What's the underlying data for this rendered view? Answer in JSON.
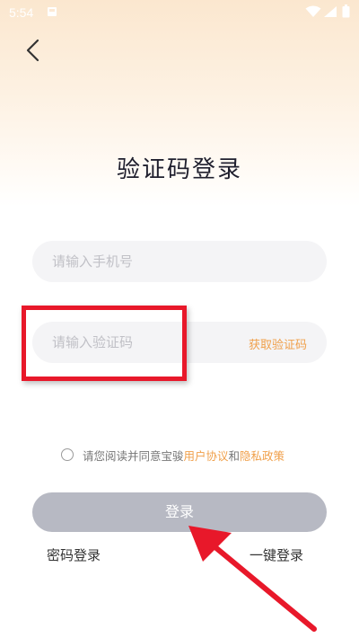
{
  "status_bar": {
    "time": "5:54"
  },
  "page": {
    "title": "验证码登录"
  },
  "form": {
    "phone_placeholder": "请输入手机号",
    "code_placeholder": "请输入验证码",
    "get_code_label": "获取验证码"
  },
  "agreement": {
    "prefix": "请您阅读并同意宝骏",
    "user_agreement": "用户协议",
    "and": "和",
    "privacy_policy": "隐私政策"
  },
  "actions": {
    "login_label": "登录",
    "password_login": "密码登录",
    "one_key_login": "一键登录"
  },
  "colors": {
    "accent": "#f0a04b",
    "button_disabled": "#b7b9c3",
    "annotation_red": "#e8182a"
  }
}
